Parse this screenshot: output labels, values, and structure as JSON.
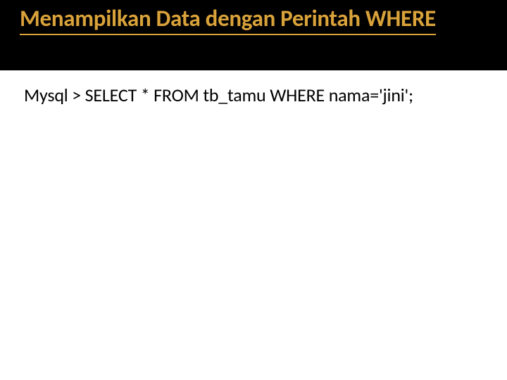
{
  "slide": {
    "title": "Menampilkan Data dengan Perintah WHERE",
    "body": "Mysql > SELECT * FROM tb_tamu WHERE nama='jini';"
  },
  "colors": {
    "title_bg": "#000000",
    "title_fg": "#d9a23a",
    "body_fg": "#000000",
    "slide_bg": "#ffffff"
  }
}
